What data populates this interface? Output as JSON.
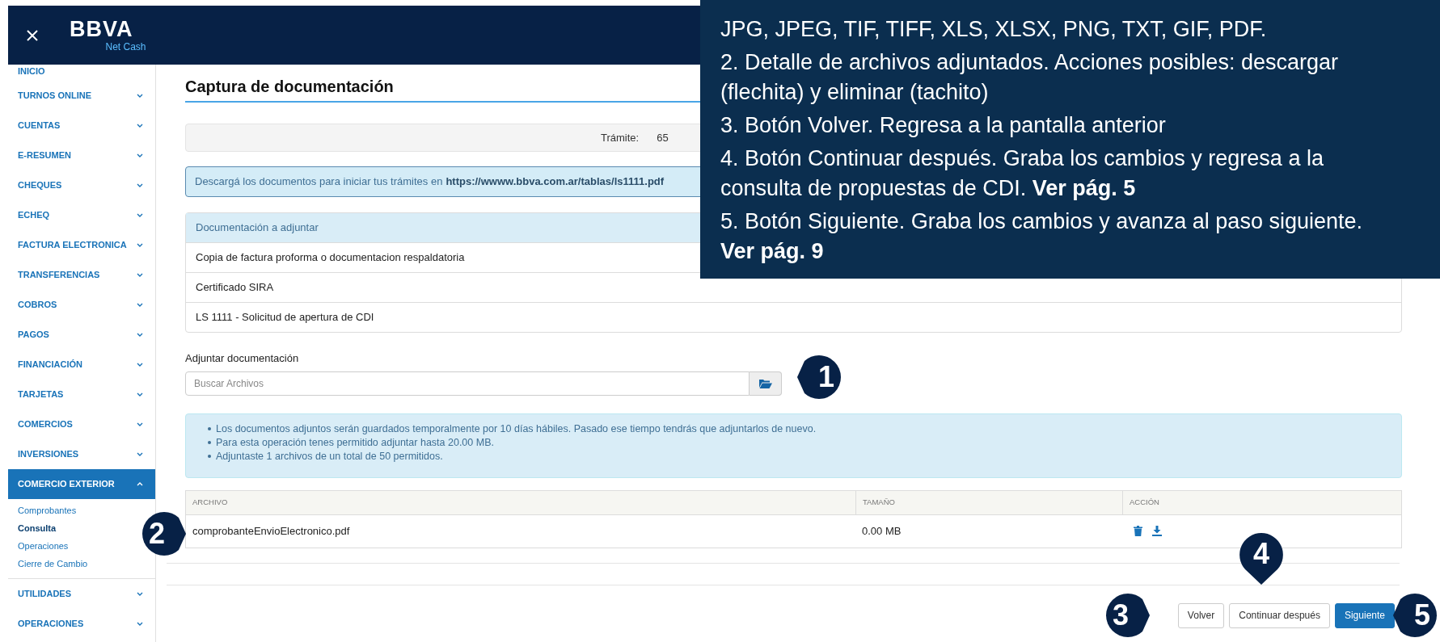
{
  "header": {
    "logo": "BBVA",
    "subtitle": "Net Cash"
  },
  "sidebar": {
    "items": [
      {
        "label": "INICIO",
        "kind": "link",
        "selected": false
      },
      {
        "label": "TURNOS ONLINE",
        "kind": "group",
        "expanded": false,
        "selected": false
      },
      {
        "label": "CUENTAS",
        "kind": "group",
        "expanded": false,
        "selected": false
      },
      {
        "label": "E-RESUMEN",
        "kind": "group",
        "expanded": false,
        "selected": false
      },
      {
        "label": "CHEQUES",
        "kind": "group",
        "expanded": false,
        "selected": false
      },
      {
        "label": "ECHEQ",
        "kind": "group",
        "expanded": false,
        "selected": false
      },
      {
        "label": "FACTURA ELECTRONICA",
        "kind": "group",
        "expanded": false,
        "selected": false
      },
      {
        "label": "TRANSFERENCIAS",
        "kind": "group",
        "expanded": false,
        "selected": false
      },
      {
        "label": "COBROS",
        "kind": "group",
        "expanded": false,
        "selected": false
      },
      {
        "label": "PAGOS",
        "kind": "group",
        "expanded": false,
        "selected": false
      },
      {
        "label": "FINANCIACIÓN",
        "kind": "group",
        "expanded": false,
        "selected": false
      },
      {
        "label": "TARJETAS",
        "kind": "group",
        "expanded": false,
        "selected": false
      },
      {
        "label": "COMERCIOS",
        "kind": "group",
        "expanded": false,
        "selected": false
      },
      {
        "label": "INVERSIONES",
        "kind": "group",
        "expanded": false,
        "selected": false
      },
      {
        "label": "COMERCIO EXTERIOR",
        "kind": "group",
        "expanded": true,
        "selected": true,
        "children": [
          {
            "label": "Comprobantes",
            "selected": false
          },
          {
            "label": "Consulta",
            "selected": true
          },
          {
            "label": "Operaciones",
            "selected": false
          },
          {
            "label": "Cierre de Cambio",
            "selected": false
          }
        ]
      },
      {
        "label": "UTILIDADES",
        "kind": "group",
        "expanded": false,
        "selected": false
      },
      {
        "label": "OPERACIONES",
        "kind": "group",
        "expanded": false,
        "selected": false
      }
    ]
  },
  "page": {
    "title": "Captura de documentación",
    "tramite": {
      "label": "Trámite:",
      "value": "65"
    },
    "notice": {
      "text": "Descargá los documentos para iniciar tus trámites en",
      "link": "https://wwww.bbva.com.ar/tablas/ls1111.pdf"
    },
    "documents": {
      "header": "Documentación a adjuntar",
      "rows": [
        "Copia de factura proforma o documentacion respaldatoria",
        "Certificado SIRA",
        "LS 1111 - Solicitud de apertura de CDI"
      ]
    },
    "attach": {
      "label": "Adjuntar documentación",
      "placeholder": "Buscar Archivos"
    },
    "info": [
      "Los documentos adjuntos serán guardados temporalmente por 10 días hábiles. Pasado ese tiempo tendrás que adjuntarlos de nuevo.",
      "Para esta operación tenes permitido adjuntar hasta 20.00 MB.",
      "Adjuntaste 1 archivos de un total de 50 permitidos."
    ],
    "files": {
      "columns": [
        "ARCHIVO",
        "TAMAÑO",
        "ACCIÓN"
      ],
      "rows": [
        {
          "file": "comprobanteEnvioElectronico.pdf",
          "size": "0.00 MB"
        }
      ]
    },
    "buttons": [
      {
        "label": "Volver",
        "kind": "secondary"
      },
      {
        "label": "Continuar después",
        "kind": "secondary"
      },
      {
        "label": "Siguiente",
        "kind": "primary"
      }
    ]
  },
  "callouts": [
    {
      "number": "1"
    },
    {
      "number": "2"
    },
    {
      "number": "3"
    },
    {
      "number": "4"
    },
    {
      "number": "5"
    }
  ],
  "tooltip": {
    "paragraphs": [
      "JPG, JPEG, TIF, TIFF, XLS, XLSX, PNG, TXT, GIF, PDF.",
      "2. Detalle de archivos adjuntados. Acciones posibles: descargar (flechita) y eliminar (tachito)",
      "3. Botón Volver. Regresa a la pantalla anterior",
      "4. Botón Continuar después. Graba los cambios y regresa a la consulta de propuestas de CDI. **Ver pág. 5**",
      "5. Botón Siguiente. Graba los cambios y avanza al paso siguiente. **Ver pág. 9**"
    ]
  }
}
